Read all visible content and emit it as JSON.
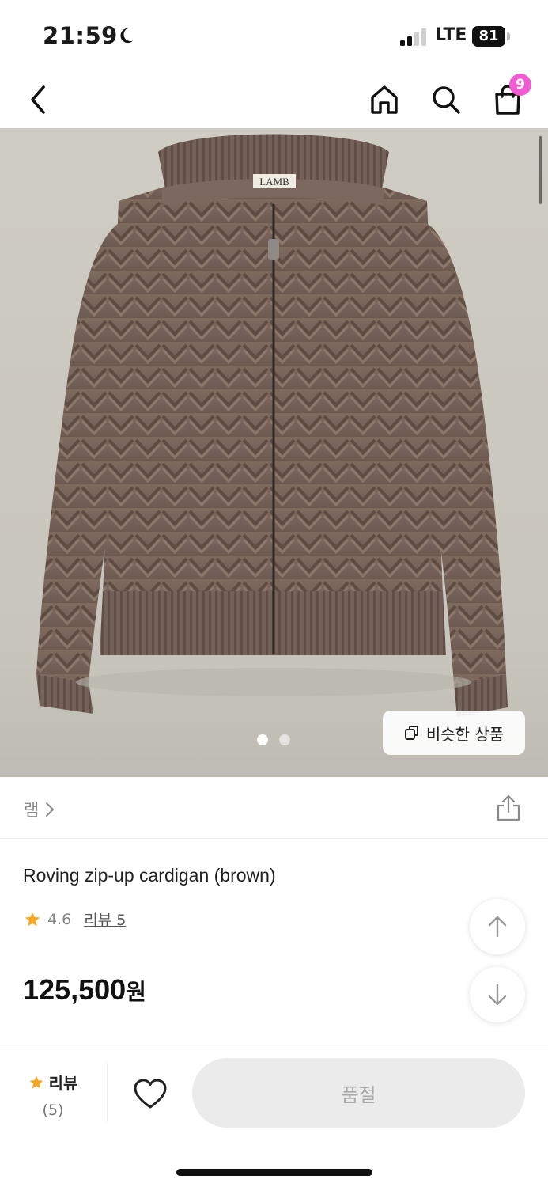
{
  "status_bar": {
    "time": "21:59",
    "network": "LTE",
    "battery": "81"
  },
  "nav": {
    "back_icon": "chevron-left-icon",
    "home_icon": "home-icon",
    "search_icon": "search-icon",
    "cart_icon": "shopping-bag-icon",
    "cart_count": "9",
    "badge_color": "#f25cd3"
  },
  "gallery": {
    "image_label": "LAMB",
    "page_count": 2,
    "current_page": 1,
    "similar_button": "비슷한 상품"
  },
  "brand": {
    "name": "램",
    "share_icon": "share-icon"
  },
  "product": {
    "name": "Roving zip-up cardigan (brown)",
    "rating": "4.6",
    "review_label": "리뷰 5",
    "price": "125,500",
    "currency": "원"
  },
  "bottom_bar": {
    "review_label": "리뷰",
    "review_count": "(5)",
    "soldout_label": "품절",
    "star_color": "#f5a623"
  }
}
